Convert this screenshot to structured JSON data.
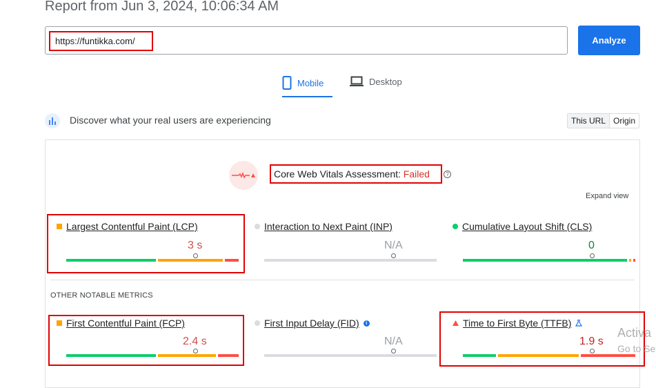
{
  "header": {
    "title": "Report from Jun 3, 2024, 10:06:34 AM"
  },
  "url_input": {
    "value": "https://funtikka.com/"
  },
  "analyze_button": {
    "label": "Analyze"
  },
  "tabs": [
    {
      "label": "Mobile",
      "active": true
    },
    {
      "label": "Desktop",
      "active": false
    }
  ],
  "discover": {
    "text": "Discover what your real users are experiencing"
  },
  "toggle": {
    "this_url": "This URL",
    "origin": "Origin"
  },
  "assessment": {
    "label": "Core Web Vitals Assessment: ",
    "status": "Failed",
    "help": "?"
  },
  "expand_view": "Expand view",
  "core_metrics": [
    {
      "label": "Largest Contentful Paint (LCP)",
      "value": "3 s",
      "status": "orange",
      "pin_fraction": 0.75
    },
    {
      "label": "Interaction to Next Paint (INP)",
      "value": "N/A",
      "status": "gray",
      "pin_fraction": 0.75
    },
    {
      "label": "Cumulative Layout Shift (CLS)",
      "value": "0",
      "status": "green",
      "pin_fraction": 0.75
    }
  ],
  "other_heading": "OTHER NOTABLE METRICS",
  "other_metrics": [
    {
      "label": "First Contentful Paint (FCP)",
      "value": "2.4 s",
      "status": "orange",
      "pin_fraction": 0.75
    },
    {
      "label": "First Input Delay (FID)",
      "value": "N/A",
      "status": "gray",
      "info": "i",
      "pin_fraction": 0.75
    },
    {
      "label": "Time to First Byte (TTFB)",
      "value": "1.9 s",
      "status": "red",
      "pin_fraction": 0.75
    }
  ],
  "watermark": {
    "line1": "Activa",
    "line2": "Go to Se"
  },
  "colors": {
    "accent": "#1a73e8",
    "good": "#0cce6b",
    "avg": "#ffa400",
    "poor": "#ff4e42",
    "fail_text": "#d93025"
  }
}
